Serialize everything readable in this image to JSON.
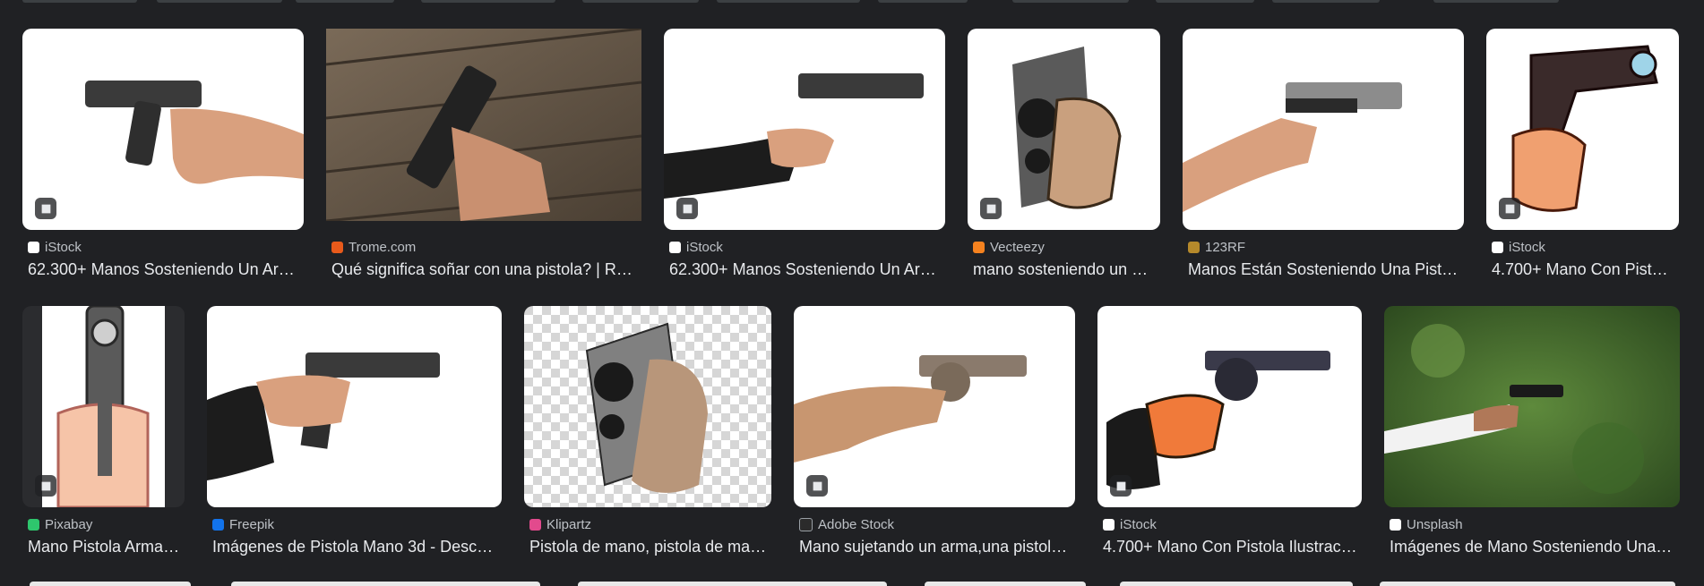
{
  "colors": {
    "background": "#202124",
    "title": "#e8eaed",
    "source": "#bdc1c6"
  },
  "row1": [
    {
      "source": "iStock",
      "title": "62.300+ Manos Sosteniendo Un Ar…",
      "favicon": "istock-icon",
      "fav_color": "#ffffff"
    },
    {
      "source": "Trome.com",
      "title": "Qué significa soñar con una pistola? | R…",
      "favicon": "trome-icon",
      "fav_color": "#e85a1b"
    },
    {
      "source": "iStock",
      "title": "62.300+ Manos Sosteniendo Un Ar…",
      "favicon": "istock-icon",
      "fav_color": "#ffffff"
    },
    {
      "source": "Vecteezy",
      "title": "mano sosteniendo un a…",
      "favicon": "vecteezy-icon",
      "fav_color": "#f5821f"
    },
    {
      "source": "123RF",
      "title": "Manos Están Sosteniendo Una Pist…",
      "favicon": "123rf-icon",
      "fav_color": "#b5892b"
    },
    {
      "source": "iStock",
      "title": "4.700+ Mano Con Pist…",
      "favicon": "istock-icon",
      "fav_color": "#ffffff"
    }
  ],
  "row2": [
    {
      "source": "Pixabay",
      "title": "Mano Pistola Arma…",
      "favicon": "pixabay-icon",
      "fav_color": "#2ec66d"
    },
    {
      "source": "Freepik",
      "title": "Imágenes de Pistola Mano 3d - Desc…",
      "favicon": "freepik-icon",
      "fav_color": "#1273eb"
    },
    {
      "source": "Klipartz",
      "title": "Pistola de mano, pistola de ma…",
      "favicon": "klipartz-icon",
      "fav_color": "#e24a8d"
    },
    {
      "source": "Adobe Stock",
      "title": "Mano sujetando un arma,una pistol…",
      "favicon": "adobe-stock-icon",
      "fav_color": "#2b2b2b"
    },
    {
      "source": "iStock",
      "title": "4.700+ Mano Con Pistola Ilustrac…",
      "favicon": "istock-icon",
      "fav_color": "#ffffff"
    },
    {
      "source": "Unsplash",
      "title": "Imágenes de Mano Sosteniendo Una…",
      "favicon": "unsplash-icon",
      "fav_color": "#ffffff"
    }
  ]
}
